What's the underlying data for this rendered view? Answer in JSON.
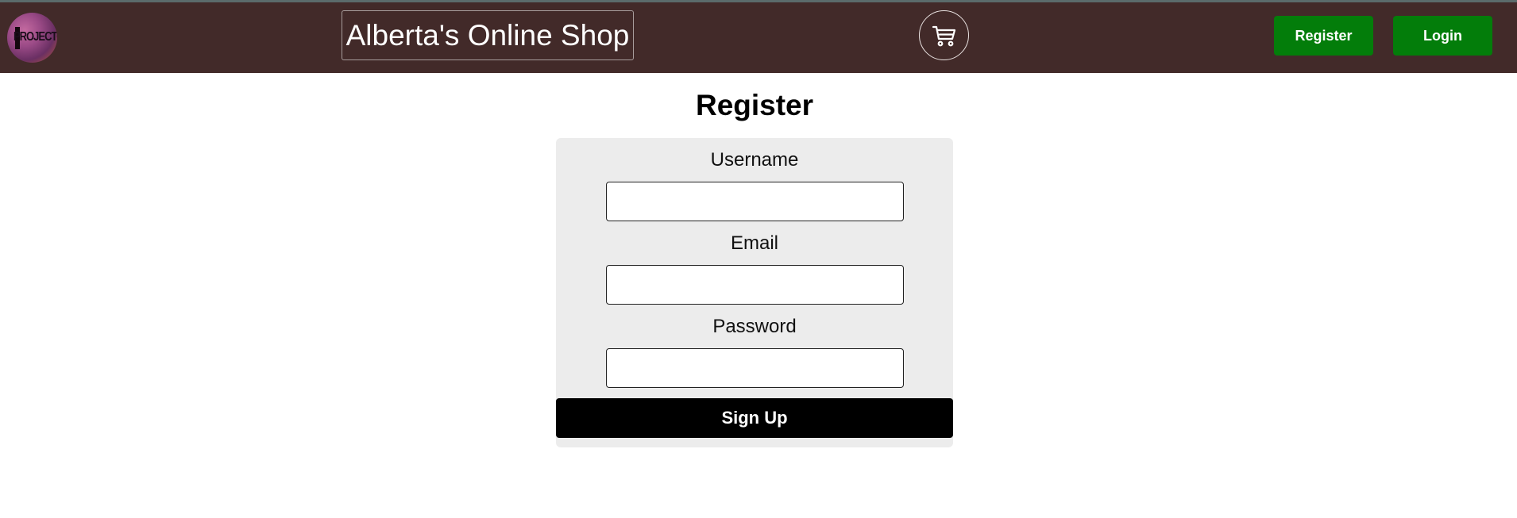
{
  "header": {
    "logo_text": "PROJECTO",
    "site_title": "Alberta's Online Shop",
    "cart_icon": "shopping-cart-icon",
    "register_label": "Register",
    "login_label": "Login",
    "colors": {
      "navbar_bg": "#422a29",
      "nav_button_bg": "#037d0a"
    }
  },
  "register_form": {
    "heading": "Register",
    "username_label": "Username",
    "username_value": "",
    "email_label": "Email",
    "email_value": "",
    "password_label": "Password",
    "password_value": "",
    "submit_label": "Sign Up",
    "colors": {
      "card_bg": "#ececec",
      "submit_bg": "#000000"
    }
  }
}
